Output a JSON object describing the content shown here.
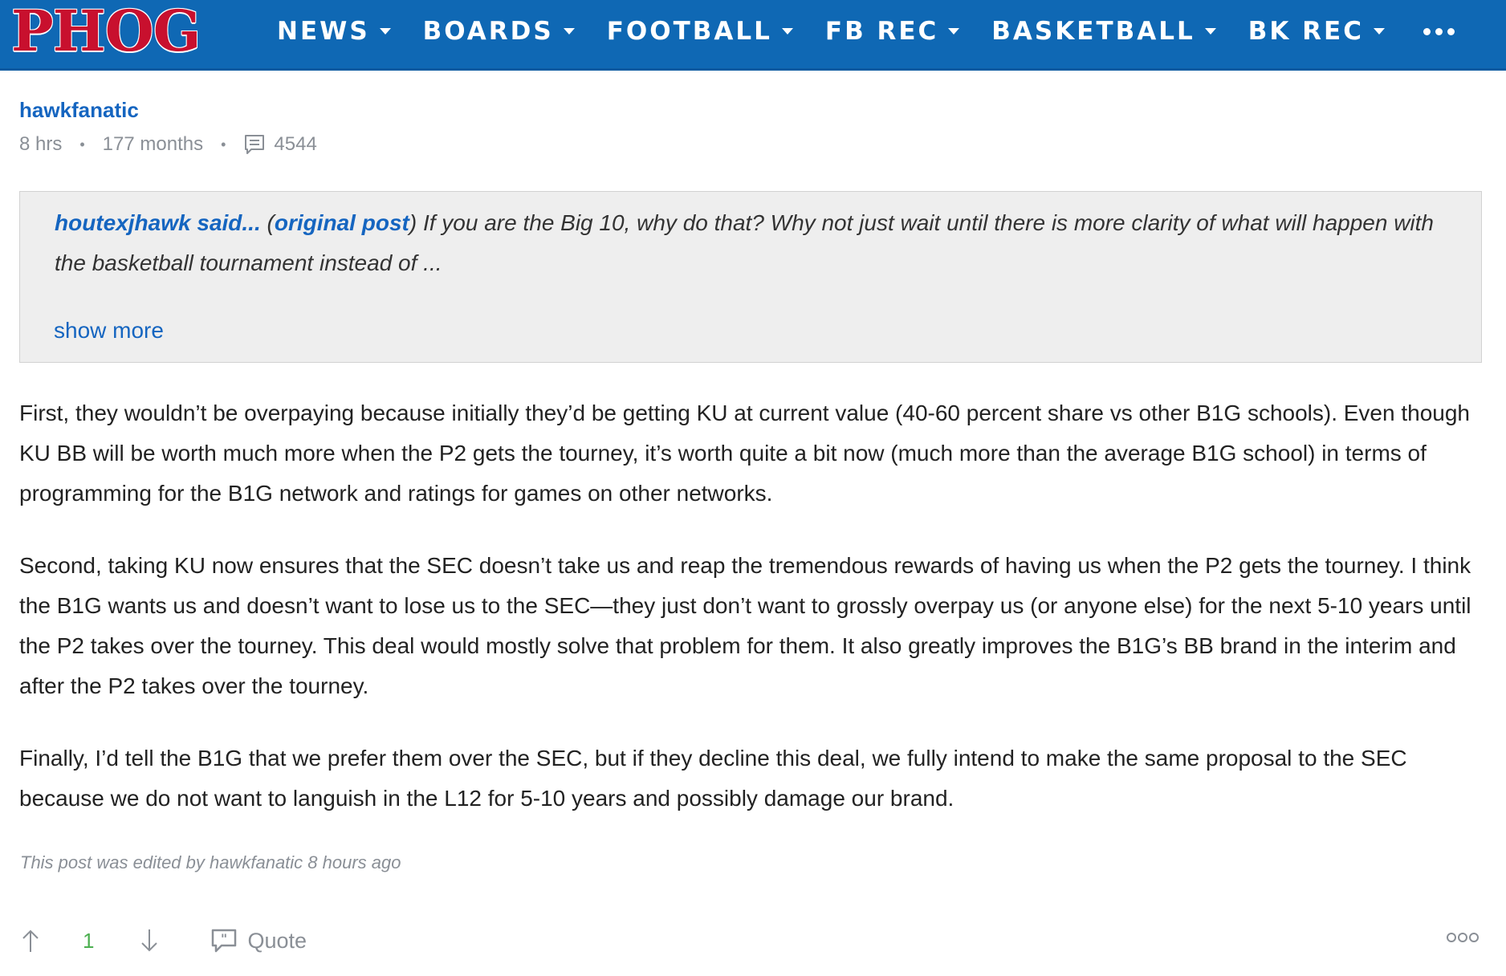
{
  "header": {
    "logo": "PHOG",
    "nav": [
      {
        "label": "NEWS"
      },
      {
        "label": "BOARDS"
      },
      {
        "label": "FOOTBALL"
      },
      {
        "label": "FB REC"
      },
      {
        "label": "BASKETBALL"
      },
      {
        "label": "BK REC"
      }
    ],
    "more_icon": "ellipsis-icon",
    "colors": {
      "bar": "#0f68b4",
      "logo": "#c8102e"
    }
  },
  "post": {
    "author": "hawkfanatic",
    "time": "8 hrs",
    "tenure": "177 months",
    "post_count": "4544",
    "quote": {
      "who": "houtexjhawk said...",
      "open_paren": "(",
      "link": "original post",
      "close_paren": ")",
      "text": " If you are the Big 10, why do that? Why not just wait until there is more clarity of what will happen with the basketball tournament instead of ...",
      "show_more": "show more"
    },
    "paragraphs": [
      "First, they wouldn’t be overpaying because initially they’d be getting KU at current value (40-60 percent share vs other B1G schools). Even though KU BB will be worth much more when the P2 gets the tourney, it’s worth quite a bit now (much more than the average B1G school) in terms of programming for the B1G network and ratings for games on other networks.",
      "Second, taking KU now ensures that the SEC doesn’t take us and reap the tremendous rewards of having us when the P2 gets the tourney. I think the B1G wants us and doesn’t want to lose us to the SEC—they just don’t want to grossly overpay us (or anyone else) for the next 5-10 years until the P2 takes over the tourney. This deal would mostly solve that problem for them. It also greatly improves the B1G’s BB brand in the interim and after the P2 takes over the tourney.",
      "Finally, I’d tell the B1G that we prefer them over the SEC, but if they decline this deal, we fully intend to make the same proposal to the SEC because we do not want to languish in the L12 for 5-10 years and possibly damage our brand."
    ],
    "edited_note": "This post was edited by hawkfanatic 8 hours ago",
    "vote_count": "1",
    "quote_label": "Quote",
    "colors": {
      "link": "#1565c0",
      "vote": "#4caf50"
    }
  }
}
